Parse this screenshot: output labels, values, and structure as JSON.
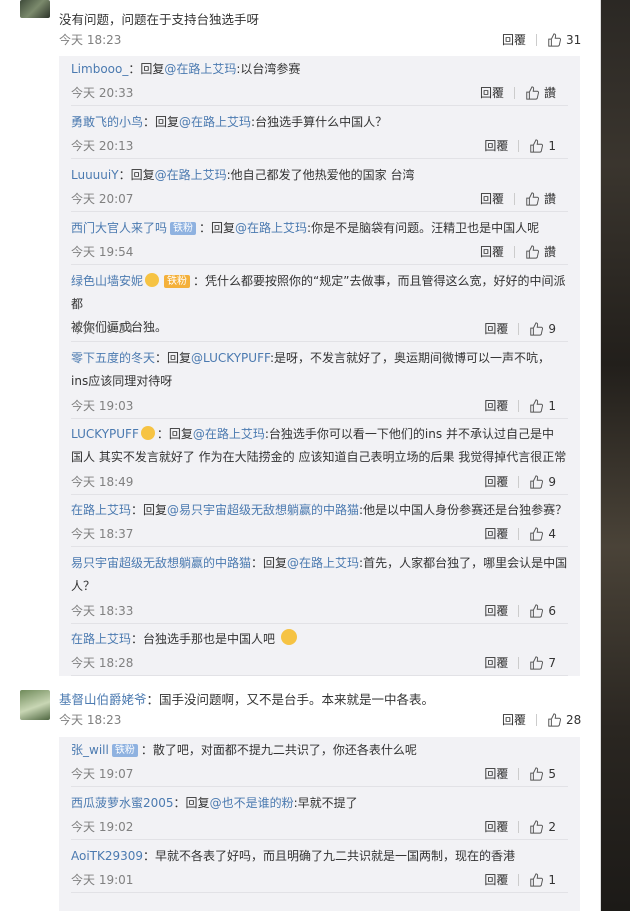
{
  "comment1": {
    "text": "没有问题，问题在于支持台独选手呀",
    "time": "今天 18:23",
    "reply_label": "回覆",
    "likes": "31"
  },
  "replies1": [
    {
      "user": "Limbooo_",
      "middle": "：回复",
      "at": "@在路上艾玛",
      "rest": ":以台湾参赛",
      "line2": "",
      "time": "今天 20:33",
      "reply": "回覆",
      "likes": "讚"
    },
    {
      "user": "勇敢飞的小鸟",
      "middle": "：回复",
      "at": "@在路上艾玛",
      "rest": ":台独选手算什么中国人？",
      "line2": "",
      "time": "今天 20:13",
      "reply": "回覆",
      "likes": "1"
    },
    {
      "user": "LuuuuiY",
      "middle": "：回复",
      "at": "@在路上艾玛",
      "rest": ":他自己都发了他热爱他的国家 台湾",
      "line2": "",
      "time": "今天 20:07",
      "reply": "回覆",
      "likes": "讚"
    },
    {
      "user": "西门大官人来了吗",
      "badge": "铁粉",
      "middle": "：回复",
      "at": "@在路上艾玛",
      "rest": ":你是不是脑袋有问题。汪精卫也是中国人呢",
      "line2": "",
      "time": "今天 19:54",
      "reply": "回覆",
      "likes": "讚"
    },
    {
      "user": "绿色山墙安妮",
      "emoji": true,
      "badge": "铁粉",
      "middle": "：凭什么都要按照你的“规定”去做事，而且管得这么宽，好好的中间派都",
      "at": "",
      "rest": "",
      "line2": "被你们逼成台独。",
      "time": "今天 19:34",
      "reply": "回覆",
      "likes": "9"
    },
    {
      "user": "零下五度的冬天",
      "middle": "：回复",
      "at": "@LUCKYPUFF",
      "rest": ":是呀，不发言就好了，奥运期间微博可以一声不吭，",
      "line2": "ins应该同理对待呀",
      "time": "今天 19:03",
      "reply": "回覆",
      "likes": "1"
    },
    {
      "user": "LUCKYPUFF",
      "emoji": true,
      "middle": "：回复",
      "at": "@在路上艾玛",
      "rest": ":台独选手你可以看一下他们的ins 并不承认过自己是中",
      "line2": "国人 其实不发言就好了 作为在大陆捞金的 应该知道自己表明立场的后果 我觉得掉代言很正常",
      "time": "今天 18:49",
      "reply": "回覆",
      "likes": "9"
    },
    {
      "user": "在路上艾玛",
      "middle": "：回复",
      "at": "@易只宇宙超级无敌想躺赢的中路猫",
      "rest": ":他是以中国人身份参赛还是台独参赛？",
      "line2": "",
      "time": "今天 18:37",
      "reply": "回覆",
      "likes": "4"
    },
    {
      "user": "易只宇宙超级无敌想躺赢的中路猫",
      "middle": "：回复",
      "at": "@在路上艾玛",
      "rest": ":首先，人家都台独了，哪里会认是中国",
      "line2": "人？",
      "time": "今天 18:33",
      "reply": "回覆",
      "likes": "6"
    },
    {
      "user": "在路上艾玛",
      "middle": "：台独选手那也是中国人吧",
      "at": "",
      "rest": "",
      "laugh": true,
      "line2": "",
      "time": "今天 18:28",
      "reply": "回覆",
      "likes": "7"
    }
  ],
  "comment2": {
    "user": "基督山伯爵姥爷",
    "text": "：国手没问题啊，又不是台手。本来就是一中各表。",
    "time": "今天 18:23",
    "reply_label": "回覆",
    "likes": "28"
  },
  "replies2": [
    {
      "user": "张_will",
      "badge": "铁粉",
      "middle": "：散了吧，对面都不提九二共识了，你还各表什么呢",
      "at": "",
      "rest": "",
      "line2": "",
      "time": "今天 19:07",
      "reply": "回覆",
      "likes": "5"
    },
    {
      "user": "西瓜菠萝水蜜2005",
      "middle": "：回复",
      "at": "@也不是谁的粉",
      "rest": ":早就不提了",
      "line2": "",
      "time": "今天 19:02",
      "reply": "回覆",
      "likes": "2"
    },
    {
      "user": "AoiTK29309",
      "middle": "：早就不各表了好吗，而且明确了九二共识就是一国两制，现在的香港",
      "at": "",
      "rest": "",
      "line2": "",
      "time": "今天 19:01",
      "reply": "回覆",
      "likes": "1"
    }
  ]
}
